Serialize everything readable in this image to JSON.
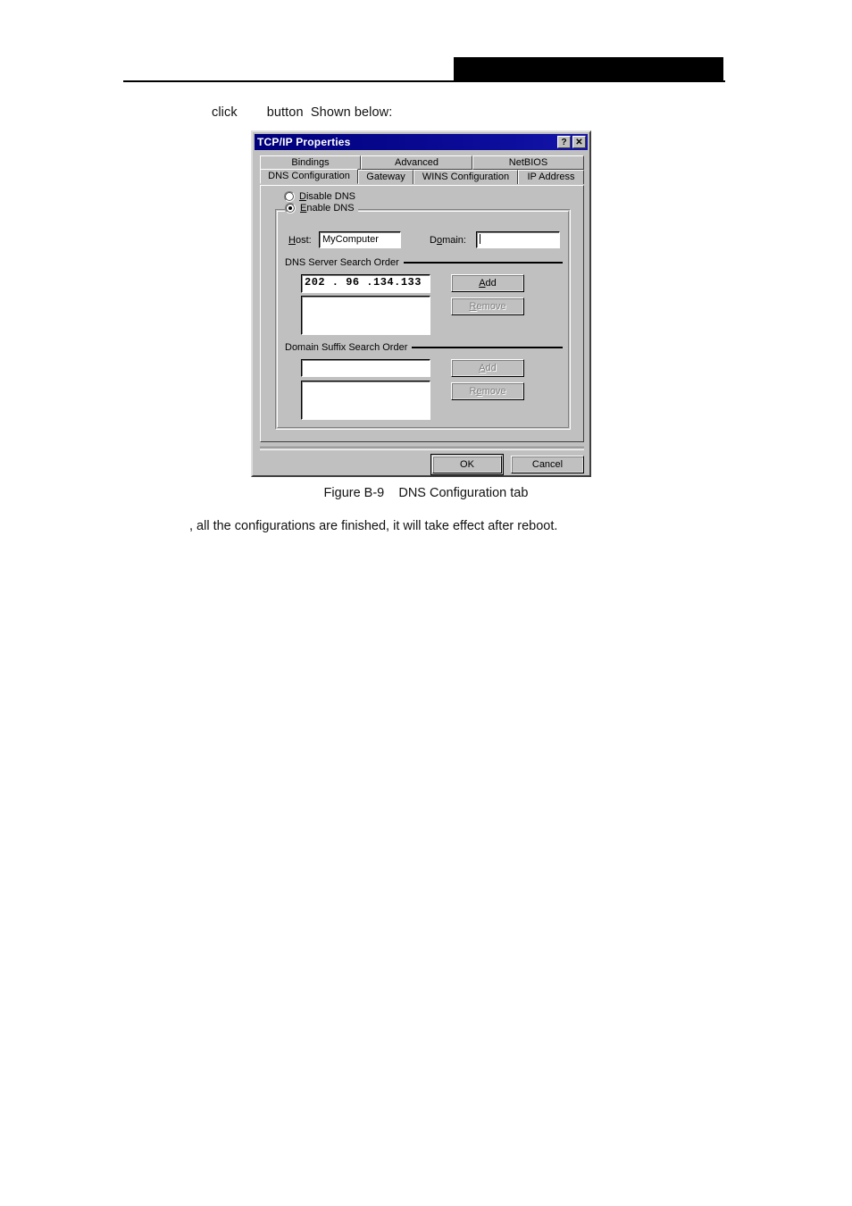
{
  "page": {
    "intro_text": "click        button  Shown below:",
    "figure_caption": "Figure B-9    DNS Configuration tab",
    "footer_text": ", all the configurations are finished, it will take effect after reboot."
  },
  "dialog": {
    "title": "TCP/IP Properties",
    "titlebar_buttons": [
      {
        "name": "help-button",
        "glyph": "?"
      },
      {
        "name": "close-button",
        "glyph": "✕"
      }
    ],
    "tabs_row1": [
      {
        "label": "Bindings",
        "active": false
      },
      {
        "label": "Advanced",
        "active": false
      },
      {
        "label": "NetBIOS",
        "active": false
      }
    ],
    "tabs_row2": [
      {
        "label": "DNS Configuration",
        "active": true
      },
      {
        "label": "Gateway",
        "active": false
      },
      {
        "label": "WINS Configuration",
        "active": false
      },
      {
        "label": "IP Address",
        "active": false
      }
    ],
    "radios": {
      "disable_dns": {
        "label": "Disable DNS",
        "checked": false
      },
      "enable_dns": {
        "label": "Enable DNS",
        "checked": true
      }
    },
    "host": {
      "label": "Host:",
      "value": "MyComputer"
    },
    "domain": {
      "label": "Domain:",
      "value": ""
    },
    "dns_server_search_order": {
      "title": "DNS Server Search Order",
      "entry_value": "202 . 96 .134.133",
      "list_items": [],
      "add_label": "Add",
      "add_enabled": true,
      "remove_label": "Remove",
      "remove_enabled": false
    },
    "domain_suffix_search_order": {
      "title": "Domain Suffix Search Order",
      "entry_value": "",
      "list_items": [],
      "add_label": "Add",
      "add_enabled": false,
      "remove_label": "Remove",
      "remove_enabled": false
    },
    "footer_buttons": {
      "ok_label": "OK",
      "cancel_label": "Cancel"
    }
  },
  "colors": {
    "face": "#c0c0c0",
    "titlebar": "#00007b",
    "titlebar_text": "#ffffff",
    "field_bg": "#ffffff",
    "disabled_text": "#808080"
  }
}
